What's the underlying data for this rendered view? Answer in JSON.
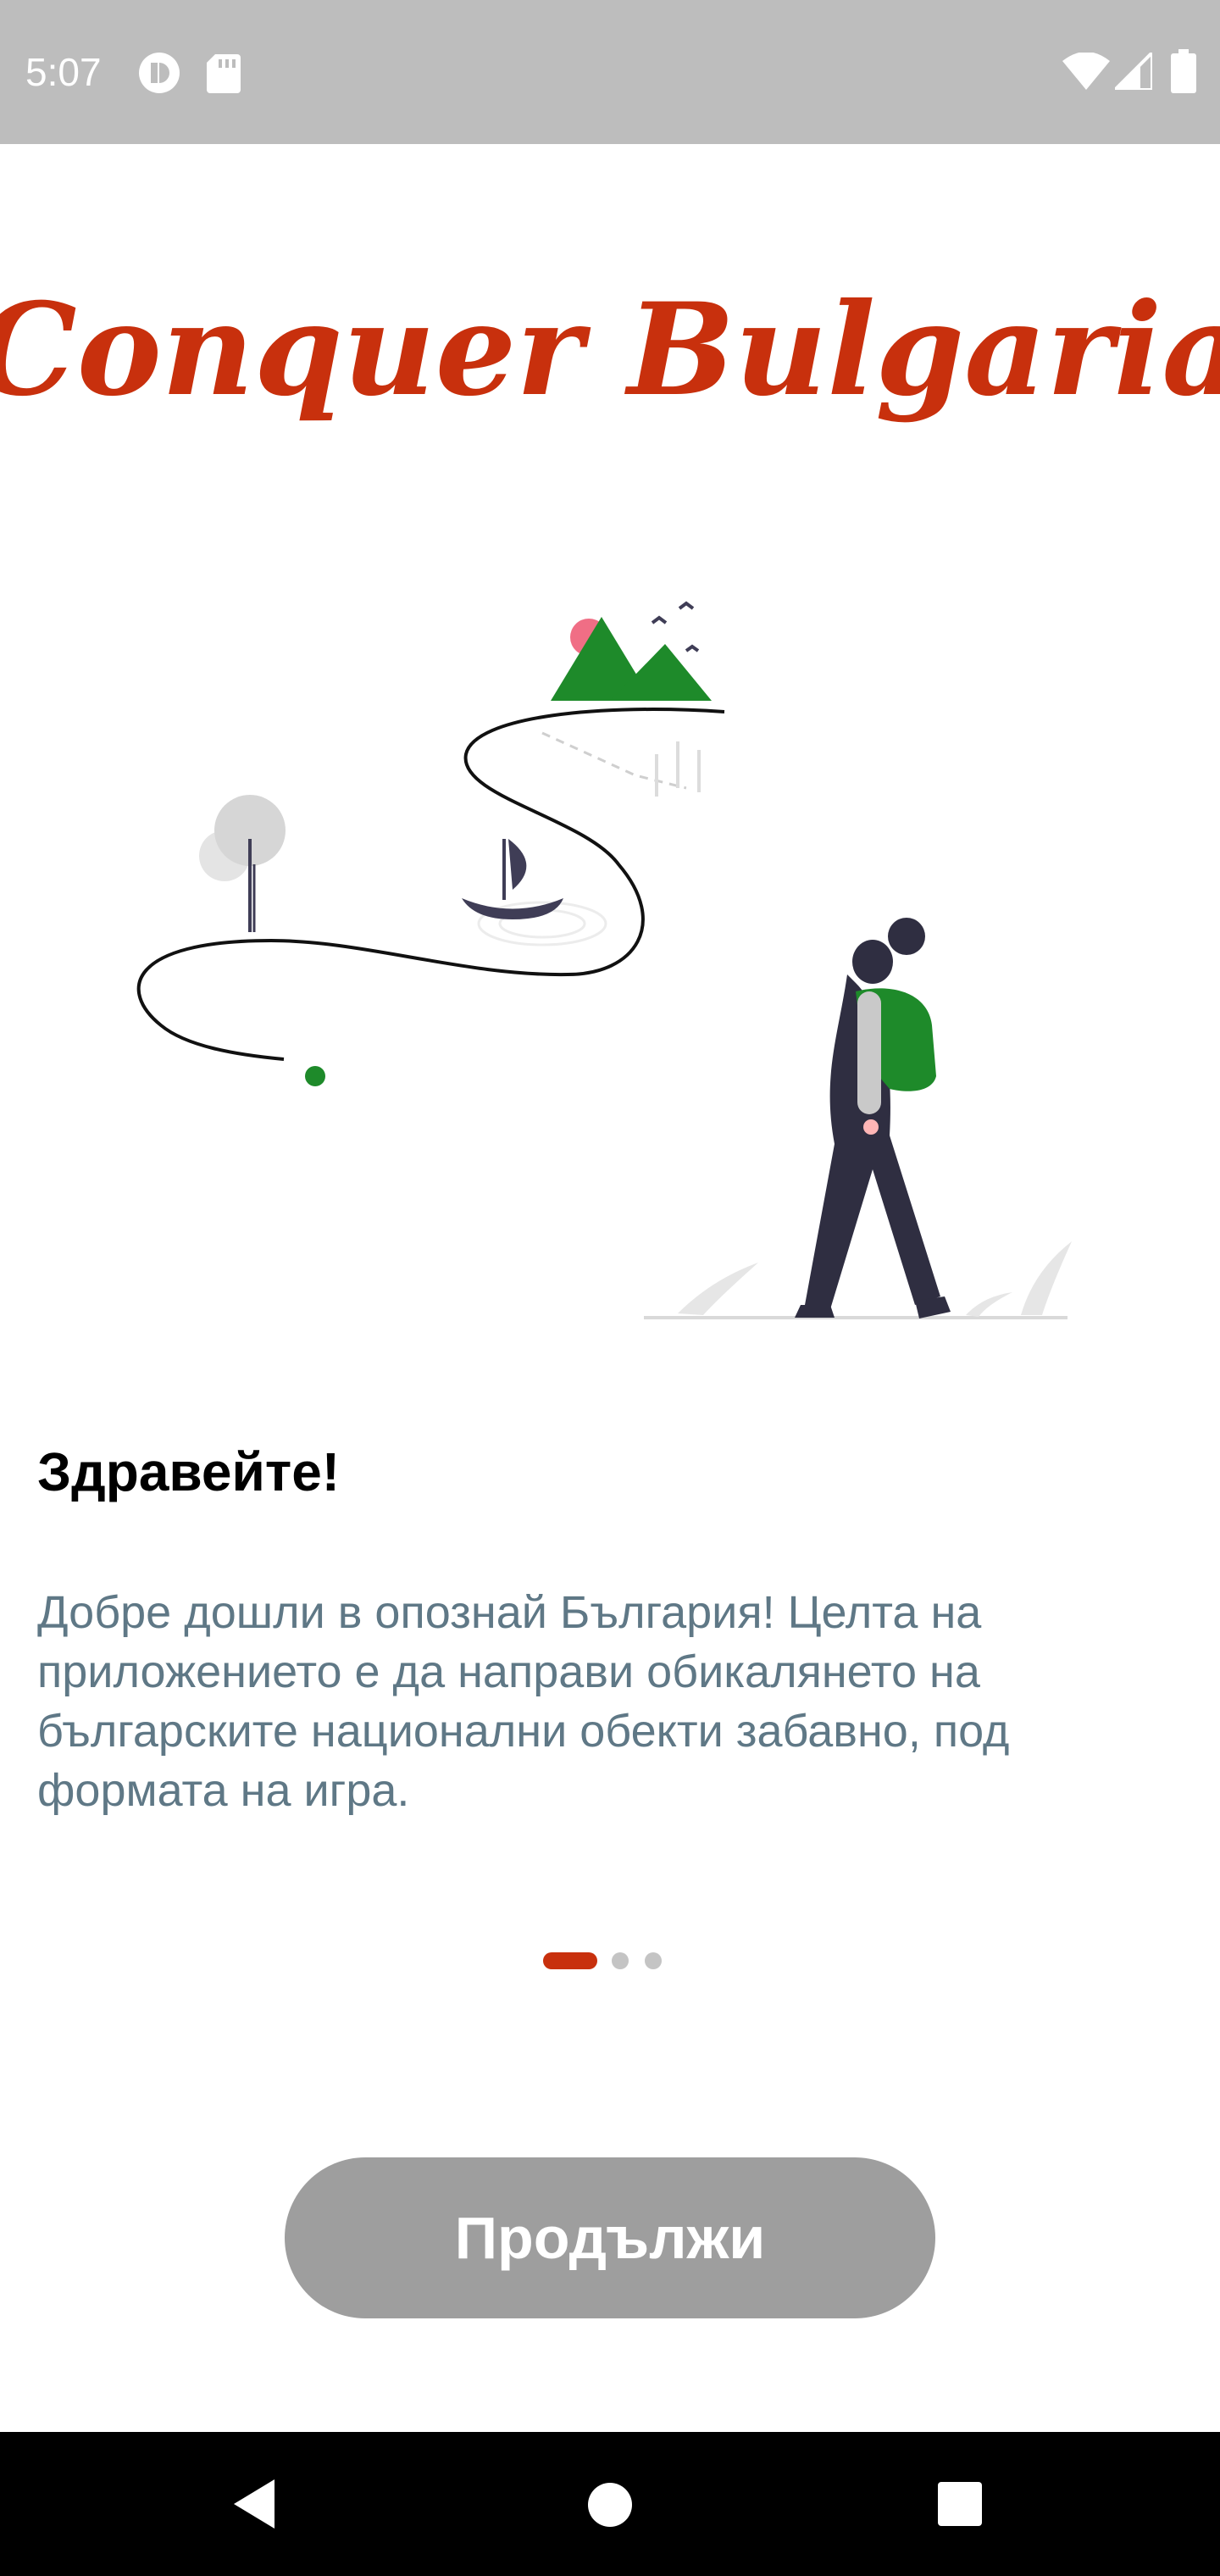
{
  "status_bar": {
    "time": "5:07",
    "left_icons": [
      "app-notification-icon",
      "sd-card-icon"
    ],
    "right_icons": [
      "wifi-icon",
      "cell-signal-icon",
      "battery-icon"
    ]
  },
  "logo": {
    "text": "Conquer Bulgaria",
    "color": "#c8300d"
  },
  "onboarding": {
    "title": "Здравейте!",
    "description": "Добре дошли в опознай България! Целта на приложението е да направи обикалянето на българските национални обекти забавно, под формата на игра.",
    "page_indicator": {
      "total": 3,
      "active": 1
    }
  },
  "continue_button": {
    "label": "Продължи"
  },
  "nav_bar": {
    "buttons": [
      "back-icon",
      "home-icon",
      "recents-icon"
    ]
  },
  "colors": {
    "accent": "#c8300d",
    "button_bg": "#9e9e9e",
    "text_secondary": "#5f7886",
    "green": "#1e8a2a"
  }
}
